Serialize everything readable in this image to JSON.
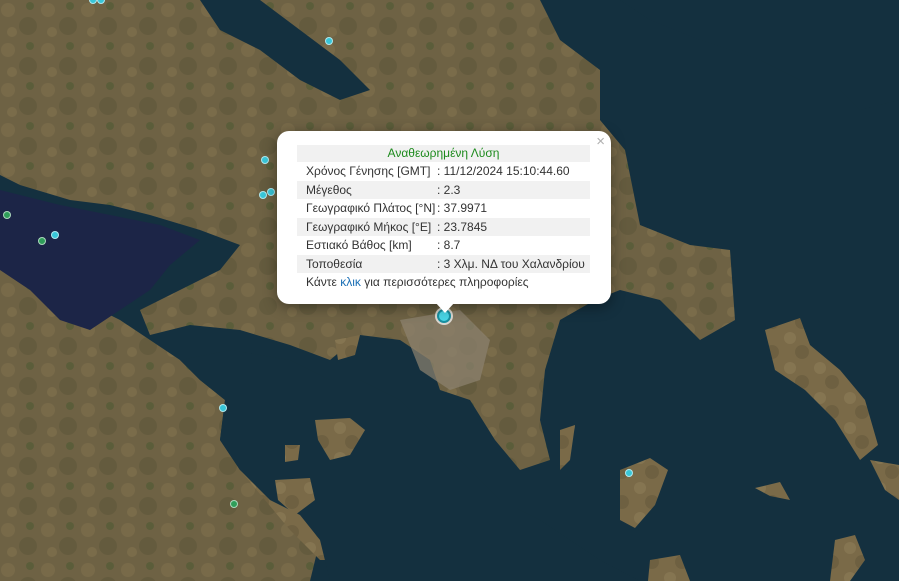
{
  "map": {
    "colors": {
      "sea": "#14303f",
      "land": "#6e6244",
      "gulf": "#1c2547",
      "marker_cyan": "#38c6d8",
      "marker_green": "#2f9e5a"
    },
    "markers": [
      {
        "name": "epicenter-marker-1",
        "color": "cyan"
      },
      {
        "name": "epicenter-marker-2",
        "color": "cyan"
      },
      {
        "name": "epicenter-marker-3",
        "color": "cyan"
      },
      {
        "name": "epicenter-marker-4",
        "color": "cyan"
      },
      {
        "name": "epicenter-marker-5",
        "color": "cyan"
      },
      {
        "name": "epicenter-marker-6",
        "color": "cyan"
      },
      {
        "name": "epicenter-marker-7",
        "color": "green"
      },
      {
        "name": "epicenter-marker-8",
        "color": "green"
      },
      {
        "name": "epicenter-marker-9",
        "color": "cyan"
      },
      {
        "name": "epicenter-marker-10",
        "color": "cyan"
      },
      {
        "name": "epicenter-marker-11",
        "color": "green"
      },
      {
        "name": "epicenter-marker-12",
        "color": "cyan"
      }
    ]
  },
  "popup": {
    "title": "Αναθεωρημένη Λύση",
    "close_symbol": "×",
    "rows": [
      {
        "label": "Χρόνος Γένησης [GMT]",
        "value": ": 11/12/2024 15:10:44.60"
      },
      {
        "label": "Μέγεθος",
        "value": ": 2.3"
      },
      {
        "label": "Γεωγραφικό Πλάτος [°N]",
        "value": ": 37.9971"
      },
      {
        "label": "Γεωγραφικό Μήκος [°E]",
        "value": ": 23.7845"
      },
      {
        "label": "Εστιακό Βάθος [km]",
        "value": ": 8.7"
      },
      {
        "label": "Τοποθεσία",
        "value": ": 3 Χλμ. ΝΔ του Χαλανδρίου"
      }
    ],
    "more_prefix": "Κάντε ",
    "more_link": "κλικ",
    "more_suffix": " για περισσότερες πληροφορίες"
  }
}
